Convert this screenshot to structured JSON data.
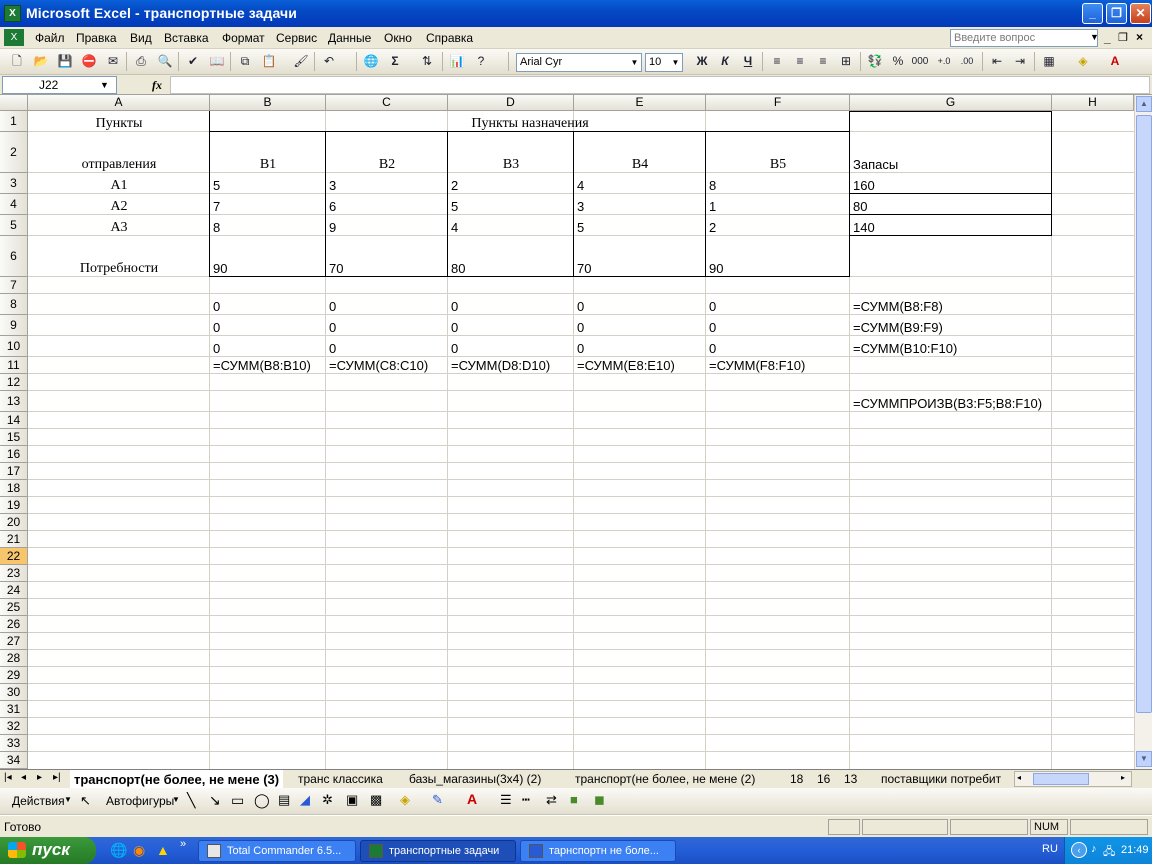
{
  "window": {
    "title": "Microsoft Excel - транспортные задачи",
    "app_icon": "X"
  },
  "menu": {
    "items": [
      "Файл",
      "Правка",
      "Вид",
      "Вставка",
      "Формат",
      "Сервис",
      "Данные",
      "Окно",
      "Справка"
    ],
    "help_placeholder": "Введите вопрос"
  },
  "toolbar": {
    "font": "Arial Cyr",
    "size": "10",
    "bold": "Ж",
    "italic": "К",
    "underline": "Ч",
    "percent": "%",
    "thousands": "000",
    "sum": "Σ"
  },
  "formula_bar": {
    "name_box": "J22",
    "fx": "fx",
    "value": ""
  },
  "columns": [
    "A",
    "B",
    "C",
    "D",
    "E",
    "F",
    "G",
    "H"
  ],
  "rows": [
    "1",
    "2",
    "3",
    "4",
    "5",
    "6",
    "7",
    "8",
    "9",
    "10",
    "11",
    "12",
    "13",
    "14",
    "15",
    "16",
    "17",
    "18",
    "19",
    "20",
    "21",
    "22",
    "23",
    "24",
    "25",
    "26",
    "27",
    "28",
    "29",
    "30",
    "31",
    "32",
    "33",
    "34"
  ],
  "selected_row": "22",
  "cells": {
    "A1": "Пункты",
    "B1": "Пункты назначения",
    "A2": "отправления",
    "B2": "B1",
    "C2": "B2",
    "D2": "B3",
    "E2": "B4",
    "F2": "B5",
    "G2": "Запасы",
    "A3": "A1",
    "B3": "5",
    "C3": "3",
    "D3": "2",
    "E3": "4",
    "F3": "8",
    "G3": "160",
    "A4": "A2",
    "B4": "7",
    "C4": "6",
    "D4": "5",
    "E4": "3",
    "F4": "1",
    "G4": "80",
    "A5": "A3",
    "B5": "8",
    "C5": "9",
    "D5": "4",
    "E5": "5",
    "F5": "2",
    "G5": "140",
    "A6": "Потребности",
    "B6": "90",
    "C6": "70",
    "D6": "80",
    "E6": "70",
    "F6": "90",
    "B8": "0",
    "C8": "0",
    "D8": "0",
    "E8": "0",
    "F8": "0",
    "G8": "=СУММ(B8:F8)",
    "B9": "0",
    "C9": "0",
    "D9": "0",
    "E9": "0",
    "F9": "0",
    "G9": "=СУММ(B9:F9)",
    "B10": "0",
    "C10": "0",
    "D10": "0",
    "E10": "0",
    "F10": "0",
    "G10": "=СУММ(B10:F10)",
    "B11": "=СУММ(B8:B10)",
    "C11": "=СУММ(C8:C10)",
    "D11": "=СУММ(D8:D10)",
    "E11": "=СУММ(E8:E10)",
    "F11": "=СУММ(F8:F10)",
    "G13": "=СУММПРОИЗВ(B3:F5;B8:F10)"
  },
  "sheet_tabs": [
    "транспорт(не более, не мене (3)",
    "транс классика",
    "базы_магазины(3x4) (2)",
    "транспорт(не более, не мене (2)",
    "18",
    "16",
    "13",
    "поставщики потребит"
  ],
  "drawing_toolbar": {
    "actions": "Действия",
    "autoshapes": "Автофигуры"
  },
  "status": {
    "ready": "Готово",
    "num": "NUM"
  },
  "taskbar": {
    "start": "пуск",
    "tasks": [
      "Total Commander 6.5...",
      "транспортные задачи",
      "тарнспортн не боле..."
    ],
    "lang": "RU",
    "time": "21:49"
  }
}
